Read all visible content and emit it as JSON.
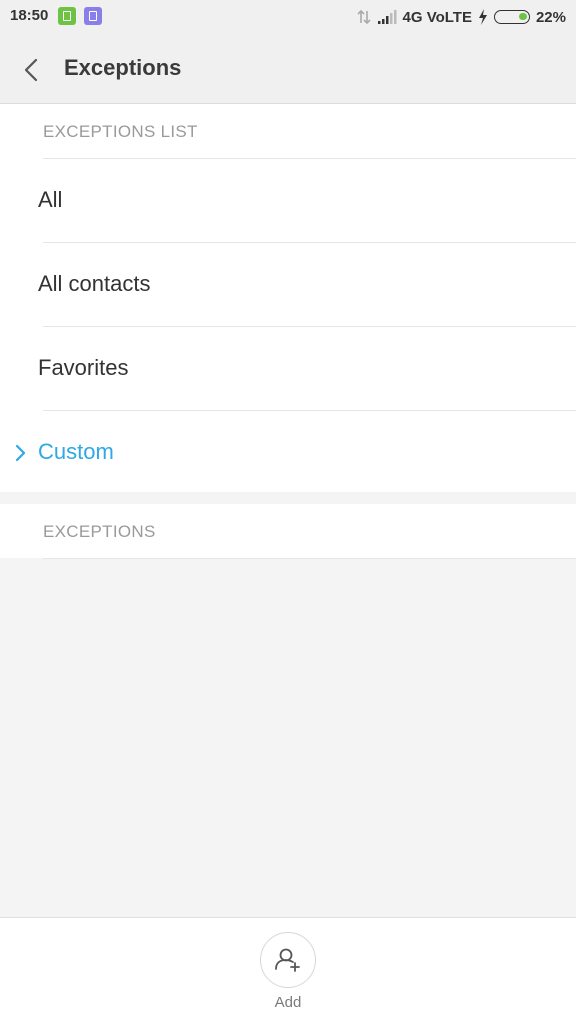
{
  "status_bar": {
    "time": "18:50",
    "network": "4G VoLTE",
    "battery": "22%",
    "battery_fill": 0.22,
    "accent_green": "#6ec344",
    "accent_purple": "#8a7fe8"
  },
  "header": {
    "title": "Exceptions"
  },
  "exceptions_list": {
    "header": "EXCEPTIONS LIST",
    "items": [
      {
        "label": "All",
        "selected": false
      },
      {
        "label": "All contacts",
        "selected": false
      },
      {
        "label": "Favorites",
        "selected": false
      },
      {
        "label": "Custom",
        "selected": true
      }
    ]
  },
  "exceptions": {
    "header": "EXCEPTIONS"
  },
  "bottom": {
    "add_label": "Add",
    "add_icon": "add-contact-icon"
  },
  "colors": {
    "accent": "#2ea8e6"
  }
}
